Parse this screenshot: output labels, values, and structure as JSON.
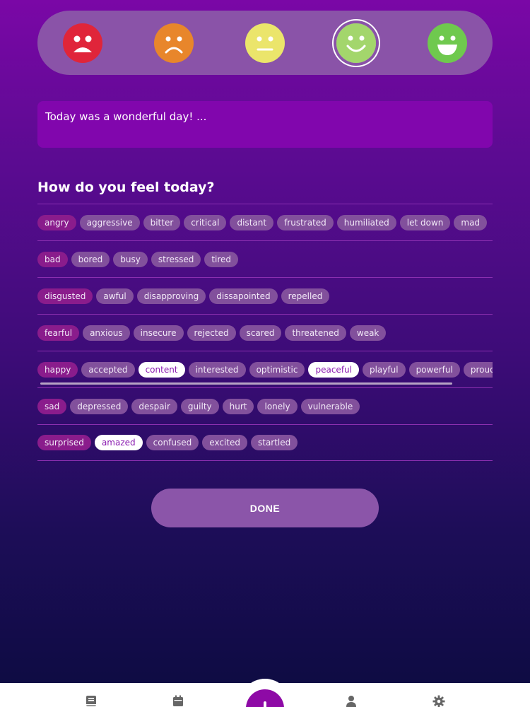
{
  "moods": [
    {
      "name": "very-sad",
      "color": "#e0253a",
      "selected": false
    },
    {
      "name": "sad",
      "color": "#e8862b",
      "selected": false
    },
    {
      "name": "neutral",
      "color": "#ebe56b",
      "selected": false
    },
    {
      "name": "happy",
      "color": "#a3d66c",
      "selected": true
    },
    {
      "name": "very-happy",
      "color": "#6fc94e",
      "selected": false
    }
  ],
  "journal": {
    "text": "Today was a wonderful day! ..."
  },
  "feelings": {
    "heading": "How do you feel today?",
    "rows": [
      {
        "category": "angry",
        "items": [
          "aggressive",
          "bitter",
          "critical",
          "distant",
          "frustrated",
          "humiliated",
          "let down",
          "mad"
        ],
        "selected": []
      },
      {
        "category": "bad",
        "items": [
          "bored",
          "busy",
          "stressed",
          "tired"
        ],
        "selected": []
      },
      {
        "category": "disgusted",
        "items": [
          "awful",
          "disapproving",
          "dissapointed",
          "repelled"
        ],
        "selected": []
      },
      {
        "category": "fearful",
        "items": [
          "anxious",
          "insecure",
          "rejected",
          "scared",
          "threatened",
          "weak"
        ],
        "selected": []
      },
      {
        "category": "happy",
        "items": [
          "accepted",
          "content",
          "interested",
          "optimistic",
          "peaceful",
          "playful",
          "powerful",
          "proud",
          ""
        ],
        "selected": [
          "content",
          "peaceful"
        ],
        "scrollable": true
      },
      {
        "category": "sad",
        "items": [
          "depressed",
          "despair",
          "guilty",
          "hurt",
          "lonely",
          "vulnerable"
        ],
        "selected": []
      },
      {
        "category": "surprised",
        "items": [
          "amazed",
          "confused",
          "excited",
          "startled"
        ],
        "selected": [
          "amazed"
        ]
      }
    ]
  },
  "done_button": {
    "label": "DONE"
  },
  "tabbar": {
    "items": [
      {
        "name": "journal-tab",
        "icon": "book-icon"
      },
      {
        "name": "calendar-tab",
        "icon": "calendar-icon"
      },
      {
        "name": "add-entry",
        "icon": "plus-icon"
      },
      {
        "name": "profile-tab",
        "icon": "person-icon"
      },
      {
        "name": "settings-tab",
        "icon": "gear-icon"
      }
    ],
    "accent": "#8e0aa6"
  }
}
